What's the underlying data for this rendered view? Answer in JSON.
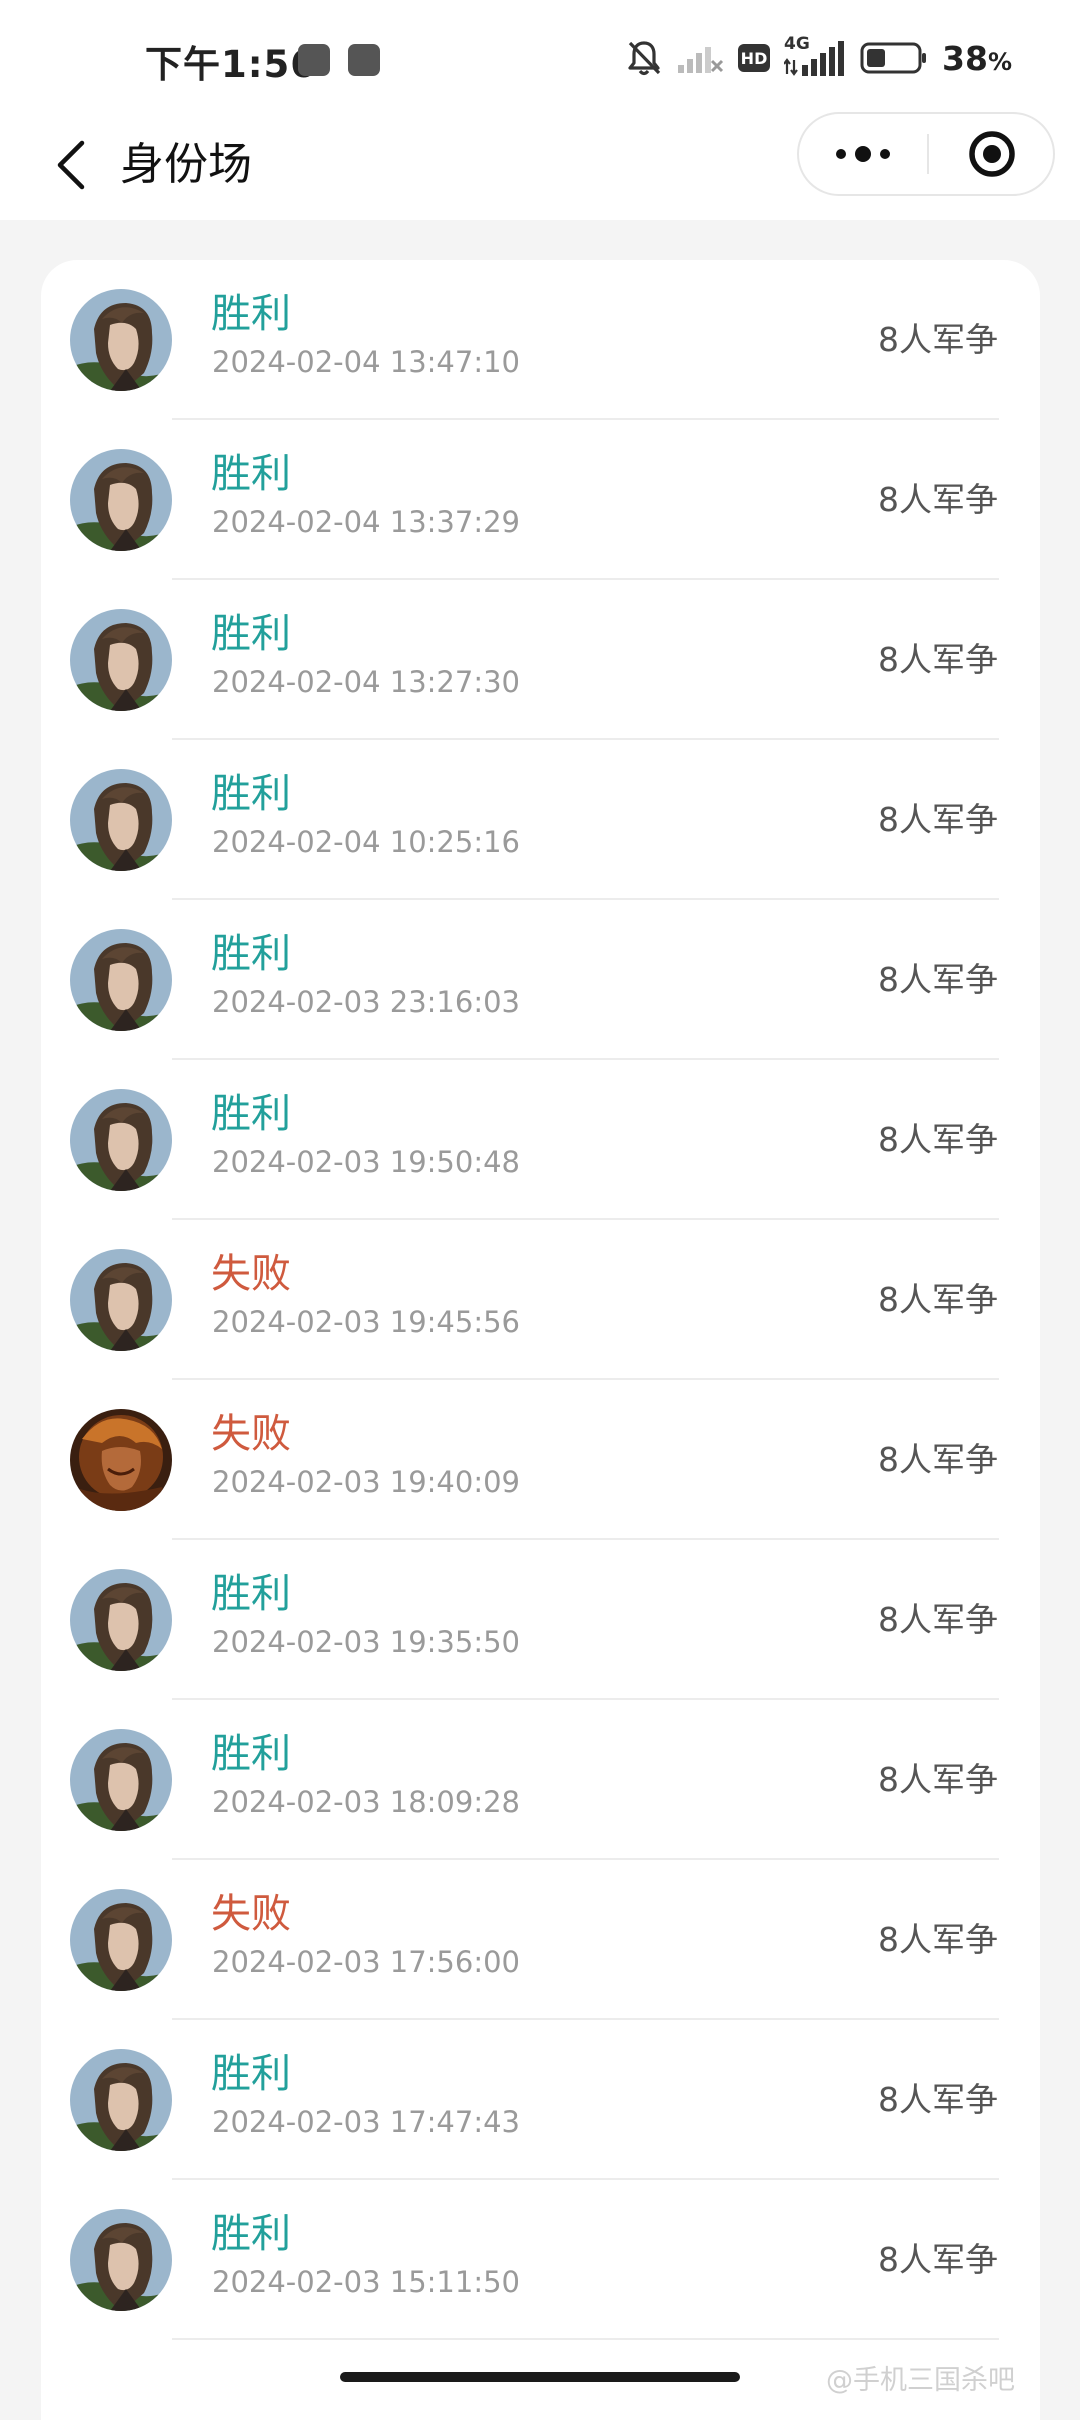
{
  "status_bar": {
    "time": "下午1:56",
    "hd_badge": "HD",
    "network": "4G",
    "battery_percent": "38",
    "battery_percent_sign": "%",
    "battery_level": 0.38,
    "icons": [
      "notification-square-icon",
      "mute-bell-icon",
      "wifi-off-icon",
      "hd-icon",
      "cellular-signal-icon",
      "battery-icon"
    ]
  },
  "nav": {
    "title": "身份场",
    "back_icon": "chevron-left-icon",
    "more_icon": "more-dots-icon",
    "close_icon": "target-circle-icon"
  },
  "records": [
    {
      "result": "胜利",
      "status": "win",
      "time": "2024-02-04 13:47:10",
      "mode": "8人军争",
      "avatar": "portrait-long-hair"
    },
    {
      "result": "胜利",
      "status": "win",
      "time": "2024-02-04 13:37:29",
      "mode": "8人军争",
      "avatar": "portrait-long-hair"
    },
    {
      "result": "胜利",
      "status": "win",
      "time": "2024-02-04 13:27:30",
      "mode": "8人军争",
      "avatar": "portrait-long-hair"
    },
    {
      "result": "胜利",
      "status": "win",
      "time": "2024-02-04 10:25:16",
      "mode": "8人军争",
      "avatar": "portrait-long-hair"
    },
    {
      "result": "胜利",
      "status": "win",
      "time": "2024-02-03 23:16:03",
      "mode": "8人军争",
      "avatar": "portrait-long-hair"
    },
    {
      "result": "胜利",
      "status": "win",
      "time": "2024-02-03 19:50:48",
      "mode": "8人军争",
      "avatar": "portrait-long-hair"
    },
    {
      "result": "失败",
      "status": "loss",
      "time": "2024-02-03 19:45:56",
      "mode": "8人军争",
      "avatar": "portrait-long-hair"
    },
    {
      "result": "失败",
      "status": "loss",
      "time": "2024-02-03 19:40:09",
      "mode": "8人军争",
      "avatar": "portrait-fire-warrior"
    },
    {
      "result": "胜利",
      "status": "win",
      "time": "2024-02-03 19:35:50",
      "mode": "8人军争",
      "avatar": "portrait-long-hair"
    },
    {
      "result": "胜利",
      "status": "win",
      "time": "2024-02-03 18:09:28",
      "mode": "8人军争",
      "avatar": "portrait-long-hair"
    },
    {
      "result": "失败",
      "status": "loss",
      "time": "2024-02-03 17:56:00",
      "mode": "8人军争",
      "avatar": "portrait-long-hair"
    },
    {
      "result": "胜利",
      "status": "win",
      "time": "2024-02-03 17:47:43",
      "mode": "8人军争",
      "avatar": "portrait-long-hair"
    },
    {
      "result": "胜利",
      "status": "win",
      "time": "2024-02-03 15:11:50",
      "mode": "8人军争",
      "avatar": "portrait-long-hair"
    }
  ],
  "colors": {
    "win": "#22a09b",
    "loss": "#cf5a3e",
    "timestamp": "#9a9a9a",
    "mode": "#555555",
    "page_background": "#f4f4f4",
    "card_background": "#ffffff"
  },
  "watermark": "@手机三国杀吧"
}
